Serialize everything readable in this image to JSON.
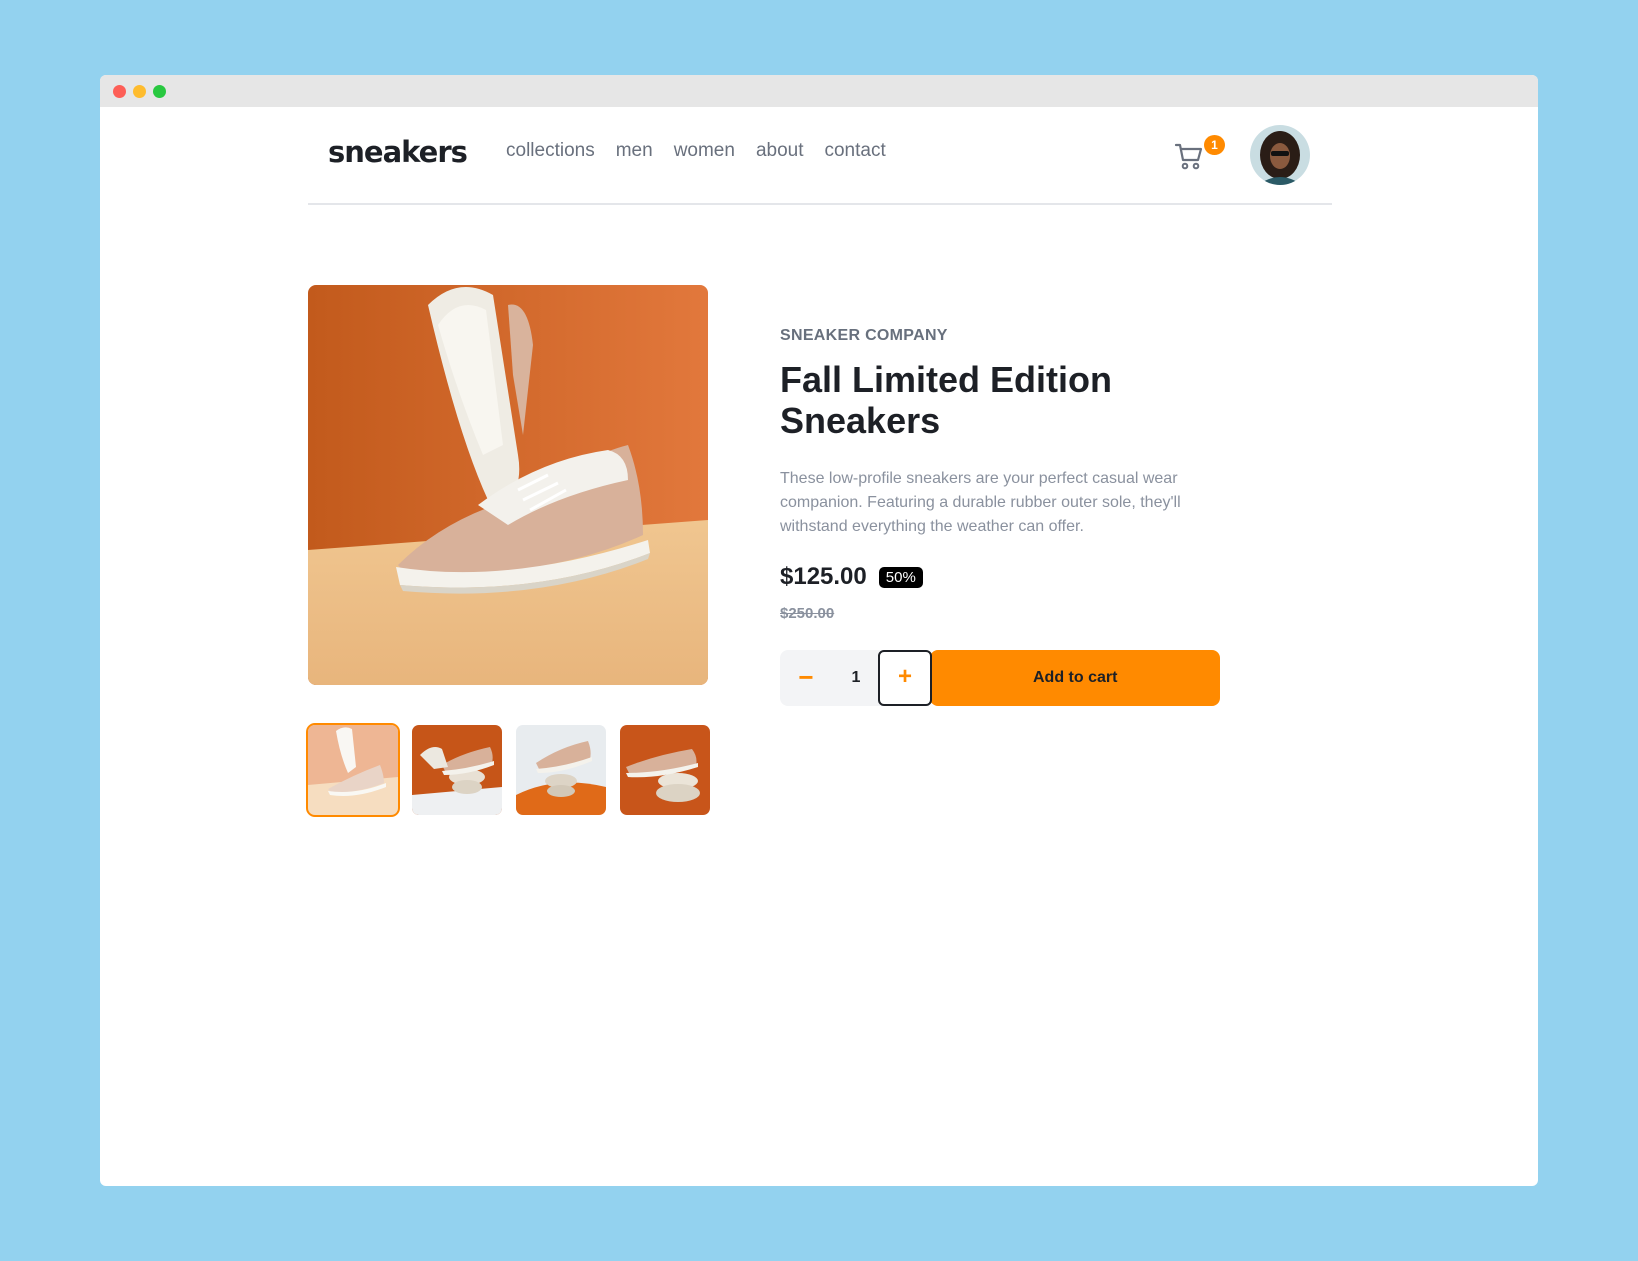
{
  "brand": {
    "logo": "sneakers"
  },
  "nav": {
    "links": [
      "collections",
      "men",
      "women",
      "about",
      "contact"
    ],
    "cart_count": "1"
  },
  "product": {
    "company": "SNEAKER COMPANY",
    "title_line1": "Fall Limited Edition",
    "title_line2": "Sneakers",
    "description": "These low-profile sneakers are your perfect casual wear companion. Featuring a durable rubber outer sole, they'll withstand everything the weather can offer.",
    "price": "$125.00",
    "discount": "50%",
    "original_price": "$250.00",
    "quantity": "1",
    "add_to_cart": "Add to cart",
    "qty_minus": "−",
    "qty_plus": "+"
  },
  "colors": {
    "accent": "#ff8a00",
    "dark": "#1d2026",
    "muted": "#69707d",
    "background": "#93d2ef"
  }
}
